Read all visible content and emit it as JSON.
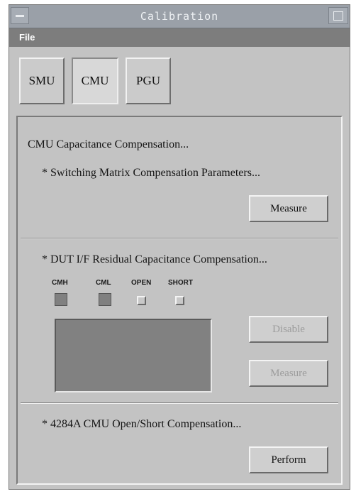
{
  "window": {
    "title": "Calibration"
  },
  "menubar": {
    "file_label": "File"
  },
  "tabs": [
    {
      "label": "SMU"
    },
    {
      "label": "CMU"
    },
    {
      "label": "PGU"
    }
  ],
  "section_cap": {
    "heading": "CMU Capacitance Compensation...",
    "switching_label": "* Switching Matrix Compensation Parameters...",
    "measure_label": "Measure"
  },
  "section_dut": {
    "heading": "* DUT I/F Residual Capacitance Compensation...",
    "indicators": [
      {
        "label": "CMH",
        "state": "on"
      },
      {
        "label": "CML",
        "state": "on"
      },
      {
        "label": "OPEN",
        "state": "off"
      },
      {
        "label": "SHORT",
        "state": "off"
      }
    ],
    "disable_label": "Disable",
    "measure_label": "Measure"
  },
  "section_open_short": {
    "heading": "* 4284A CMU Open/Short Compensation...",
    "perform_label": "Perform"
  },
  "colors": {
    "background": "#c3c3c3",
    "titlebar": "#9aa0a8",
    "menubar": "#7d7d7d",
    "display": "#818181"
  }
}
